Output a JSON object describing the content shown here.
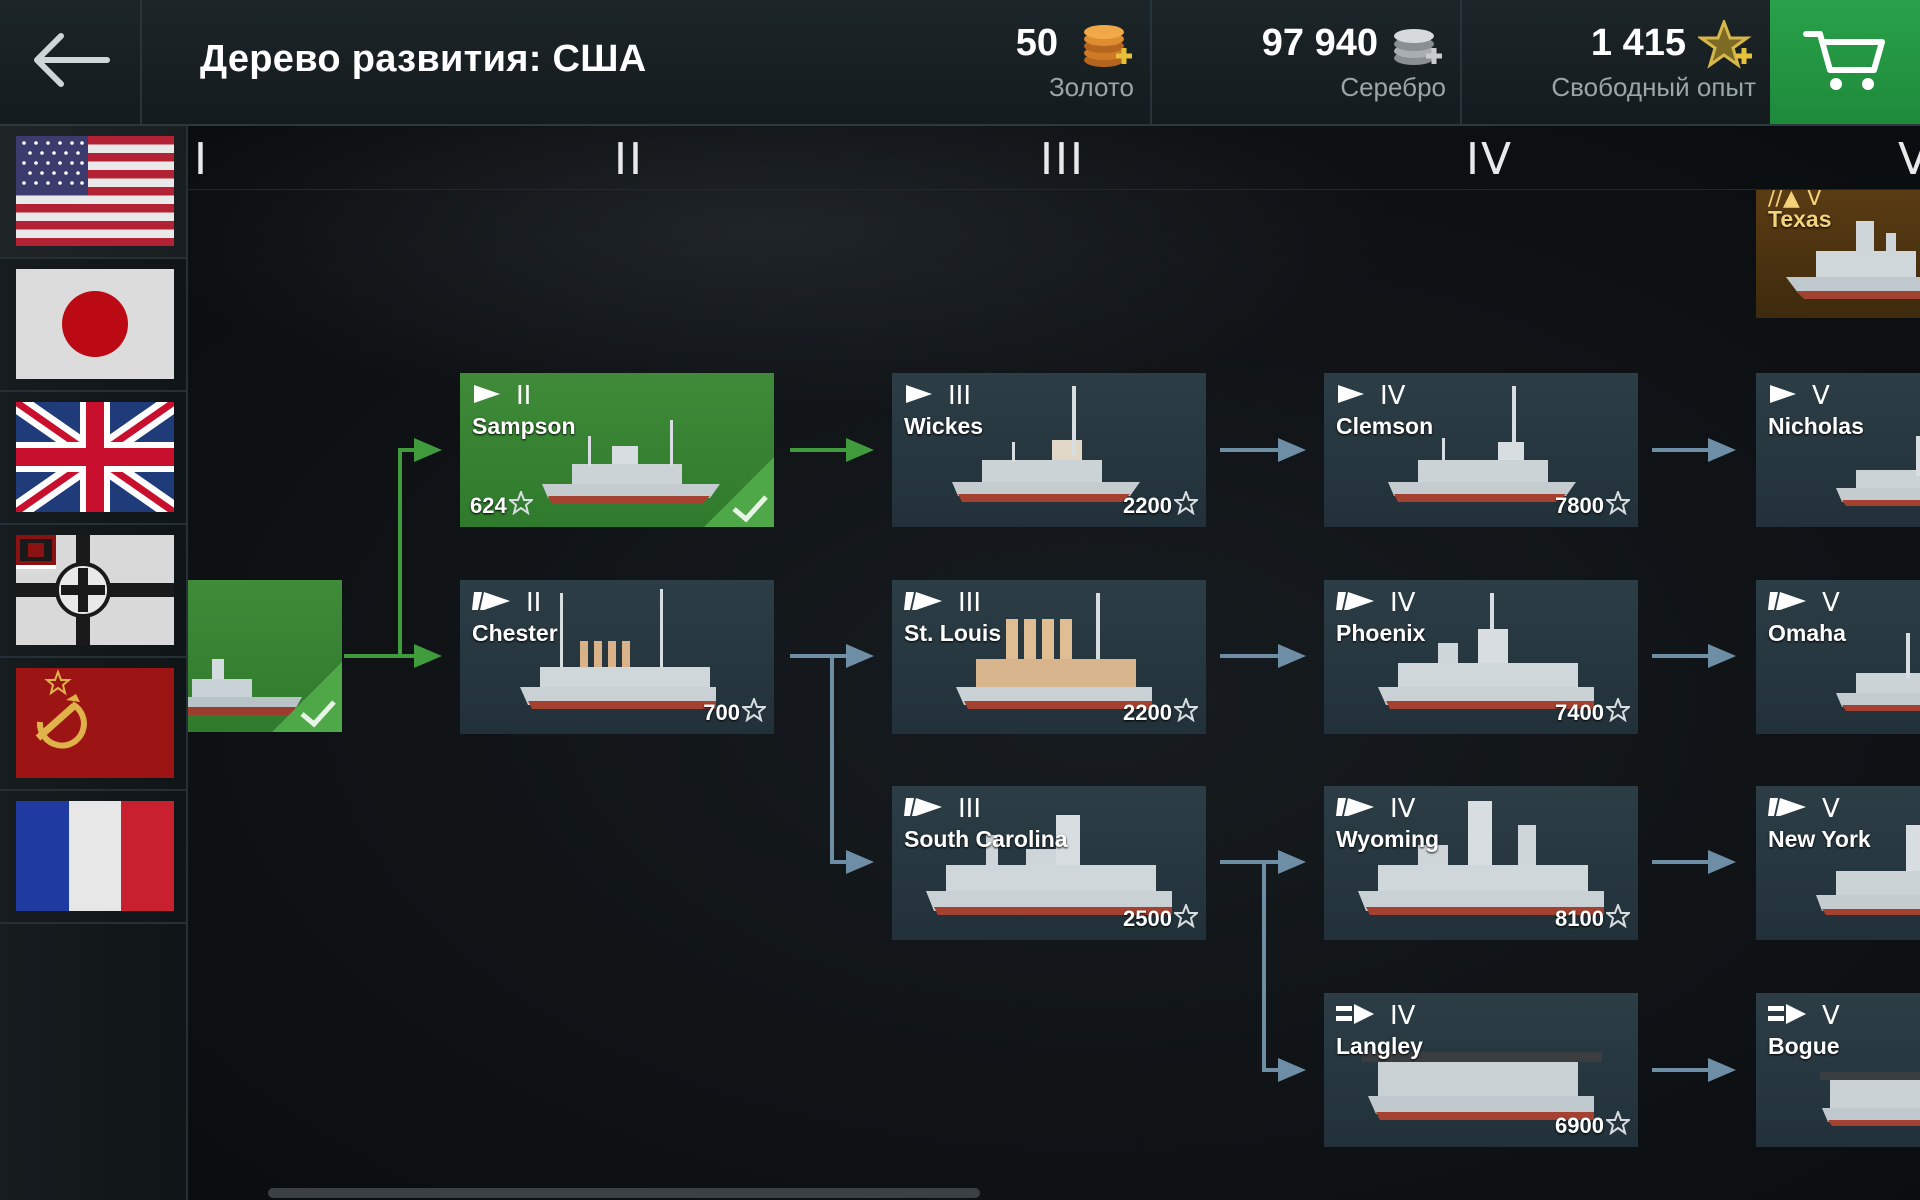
{
  "header": {
    "title": "Дерево развития: США",
    "back_icon": "arrow-left-icon",
    "cart_icon": "cart-icon"
  },
  "currencies": [
    {
      "value": "50",
      "label": "Золото",
      "icon": "gold-coins-add-icon"
    },
    {
      "value": "97 940",
      "label": "Серебро",
      "icon": "silver-coins-add-icon"
    },
    {
      "value": "1 415",
      "label": "Свободный опыт",
      "icon": "free-xp-star-add-icon"
    }
  ],
  "nations": [
    {
      "name": "usa-flag",
      "selected": true
    },
    {
      "name": "japan-flag",
      "selected": false
    },
    {
      "name": "uk-flag",
      "selected": false
    },
    {
      "name": "germany-flag",
      "selected": false
    },
    {
      "name": "ussr-flag",
      "selected": false
    },
    {
      "name": "france-flag",
      "selected": false
    }
  ],
  "tiers": [
    "I",
    "II",
    "III",
    "IV",
    "V"
  ],
  "ships": {
    "erie": {
      "name": "",
      "tier": "I",
      "class": "cruiser",
      "researched": true
    },
    "texas": {
      "name": "Texas",
      "tier": "V",
      "class": "premium",
      "researched": false
    },
    "sampson": {
      "name": "Sampson",
      "tier": "II",
      "class": "destroyer",
      "xp": "624",
      "researched": true
    },
    "wickes": {
      "name": "Wickes",
      "tier": "III",
      "class": "destroyer",
      "xp": "2200",
      "researched": false
    },
    "clemson": {
      "name": "Clemson",
      "tier": "IV",
      "class": "destroyer",
      "xp": "7800",
      "researched": false
    },
    "nicholas": {
      "name": "Nicholas",
      "tier": "V",
      "class": "destroyer",
      "researched": false
    },
    "chester": {
      "name": "Chester",
      "tier": "II",
      "class": "cruiser",
      "xp": "700",
      "researched": false
    },
    "st_louis": {
      "name": "St. Louis",
      "tier": "III",
      "class": "cruiser",
      "xp": "2200",
      "researched": false
    },
    "phoenix": {
      "name": "Phoenix",
      "tier": "IV",
      "class": "cruiser",
      "xp": "7400",
      "researched": false
    },
    "omaha": {
      "name": "Omaha",
      "tier": "V",
      "class": "cruiser",
      "researched": false
    },
    "south_carolina": {
      "name": "South Carolina",
      "tier": "III",
      "class": "battleship",
      "xp": "2500",
      "researched": false
    },
    "wyoming": {
      "name": "Wyoming",
      "tier": "IV",
      "class": "battleship",
      "xp": "8100",
      "researched": false
    },
    "new_york": {
      "name": "New York",
      "tier": "V",
      "class": "battleship",
      "researched": false
    },
    "langley": {
      "name": "Langley",
      "tier": "IV",
      "class": "carrier",
      "xp": "6900",
      "researched": false
    },
    "bogue": {
      "name": "Bogue",
      "tier": "V",
      "class": "carrier",
      "researched": false
    }
  },
  "colors": {
    "researched_green": "#3f8b39",
    "card_bg": "#2c3d46",
    "link_green": "#3f9b3c",
    "link_blue": "#6d8ea4",
    "cart_green": "#2aa14a"
  }
}
